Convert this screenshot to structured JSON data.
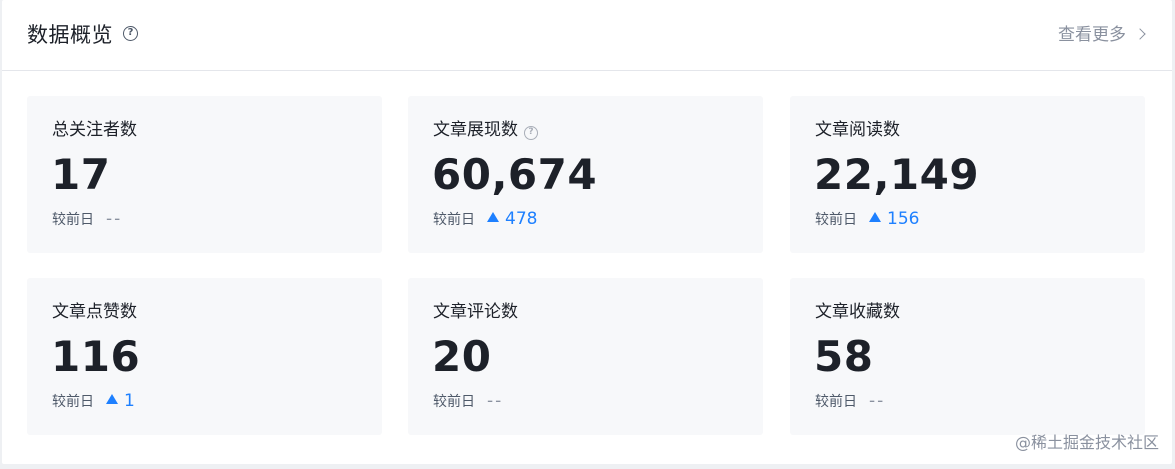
{
  "header": {
    "title": "数据概览",
    "help_icon": "question-circle",
    "more_label": "查看更多"
  },
  "compare_label": "较前日",
  "cards": [
    {
      "label": "总关注者数",
      "value": "17",
      "delta": "--",
      "trend": "flat",
      "has_help": false
    },
    {
      "label": "文章展现数",
      "value": "60,674",
      "delta": "478",
      "trend": "up",
      "has_help": true
    },
    {
      "label": "文章阅读数",
      "value": "22,149",
      "delta": "156",
      "trend": "up",
      "has_help": false
    },
    {
      "label": "文章点赞数",
      "value": "116",
      "delta": "1",
      "trend": "up",
      "has_help": false
    },
    {
      "label": "文章评论数",
      "value": "20",
      "delta": "--",
      "trend": "flat",
      "has_help": false
    },
    {
      "label": "文章收藏数",
      "value": "58",
      "delta": "--",
      "trend": "flat",
      "has_help": false
    }
  ],
  "watermark": "@稀土掘金技术社区",
  "colors": {
    "accent": "#1e80ff",
    "card_bg": "#f7f8fa",
    "text_primary": "#1d2129",
    "text_muted": "#8a919f"
  }
}
